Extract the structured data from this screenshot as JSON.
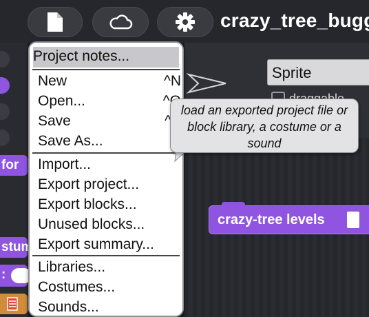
{
  "topbar": {
    "file_icon": "file-icon",
    "cloud_icon": "cloud-icon",
    "settings_icon": "gear-icon",
    "project_title": "crazy_tree_bugg"
  },
  "sprite": {
    "name_value": "Sprite",
    "draggable_label": "draggable"
  },
  "file_menu": {
    "items": [
      {
        "label": "Project notes...",
        "shortcut": ""
      },
      {
        "label": "New",
        "shortcut": "^N"
      },
      {
        "label": "Open...",
        "shortcut": "^O"
      },
      {
        "label": "Save",
        "shortcut": "^S"
      },
      {
        "label": "Save As...",
        "shortcut": ""
      },
      {
        "label": "Import...",
        "shortcut": ""
      },
      {
        "label": "Export project...",
        "shortcut": ""
      },
      {
        "label": "Export blocks...",
        "shortcut": ""
      },
      {
        "label": "Unused blocks...",
        "shortcut": ""
      },
      {
        "label": "Export summary...",
        "shortcut": ""
      },
      {
        "label": "Libraries...",
        "shortcut": ""
      },
      {
        "label": "Costumes...",
        "shortcut": ""
      },
      {
        "label": "Sounds...",
        "shortcut": ""
      }
    ]
  },
  "tooltip": {
    "text": "load an exported project file or block library, a costume or a sound"
  },
  "scripts": {
    "custom_block_label": "crazy-tree levels"
  },
  "palette_blocks": {
    "for_label": "for",
    "costume_label": "stum",
    "colon_label": ":"
  },
  "colors": {
    "block_purple": "#8f55e0",
    "menu_highlight": "#c8c8cc",
    "topbar": "#26272c"
  }
}
